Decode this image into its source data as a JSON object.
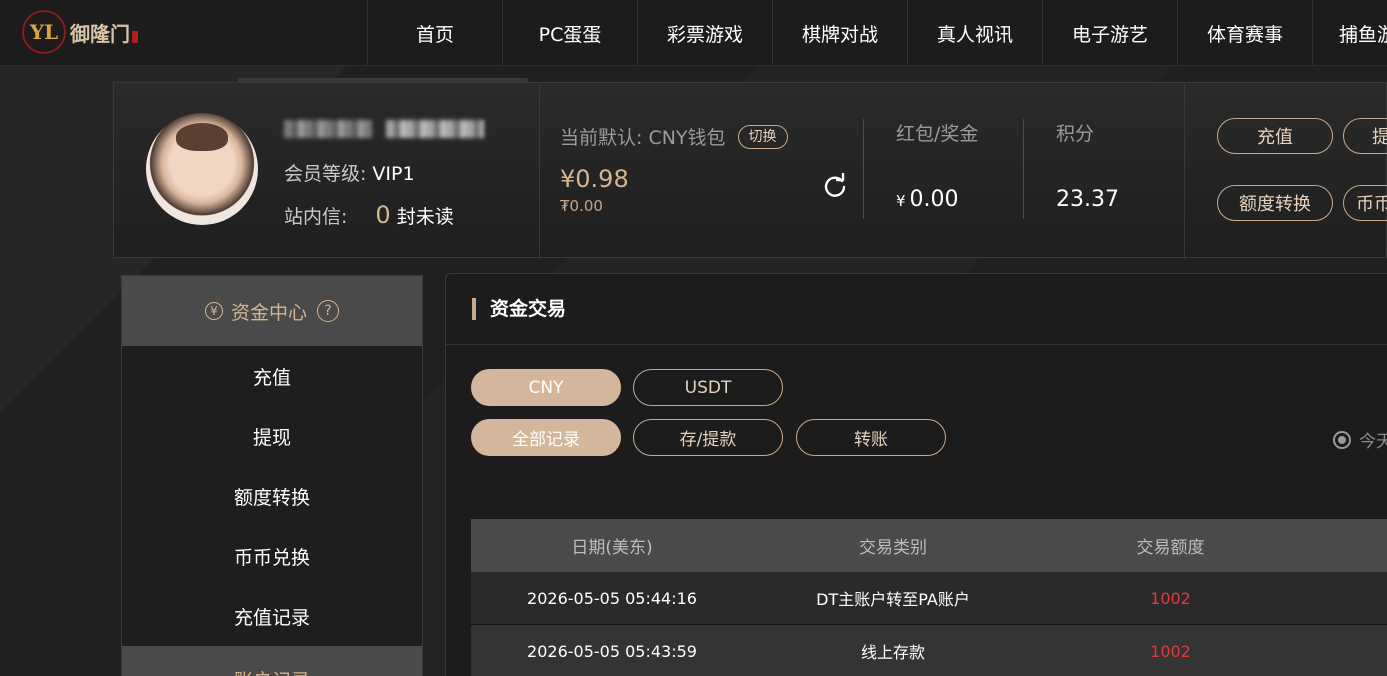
{
  "logo": {
    "text": "御隆门",
    "mark": "YL"
  },
  "nav": [
    "首页",
    "PC蛋蛋",
    "彩票游戏",
    "棋牌对战",
    "真人视讯",
    "电子游艺",
    "体育赛事",
    "捕鱼游"
  ],
  "account": {
    "vip_label": "会员等级:",
    "vip_value": "VIP1",
    "msg_label": "站内信:",
    "msg_count": "0",
    "msg_unread": "封未读",
    "wallet_label": "当前默认: CNY钱包",
    "switch_label": "切换",
    "wallet_amount": "¥0.98",
    "wallet_sub": "₮0.00",
    "bonus_label": "红包/奖金",
    "bonus_yen": "¥",
    "bonus_value": "0.00",
    "points_label": "积分",
    "points_value": "23.37",
    "actions": [
      "充值",
      "提现",
      "额度转换",
      "币币兑换"
    ]
  },
  "sidebar": {
    "heading": "资金中心",
    "items": [
      "充值",
      "提现",
      "额度转换",
      "币币兑换",
      "充值记录"
    ],
    "heading2": "账户记录"
  },
  "main": {
    "title": "资金交易",
    "currency_tabs": [
      "CNY",
      "USDT"
    ],
    "record_tabs": [
      "全部记录",
      "存/提款",
      "转账"
    ],
    "radio_label": "今天",
    "columns": [
      "日期(美东)",
      "交易类别",
      "交易额度"
    ],
    "rows": [
      {
        "date": "2026-05-05 05:44:16",
        "type": "DT主账户转至PA账户",
        "amount": "1002"
      },
      {
        "date": "2026-05-05 05:43:59",
        "type": "线上存款",
        "amount": "1002"
      }
    ]
  },
  "colors": {
    "accent": "#d4b69c",
    "amount_red": "#e23a3a",
    "panel": "#1c1c1c"
  }
}
